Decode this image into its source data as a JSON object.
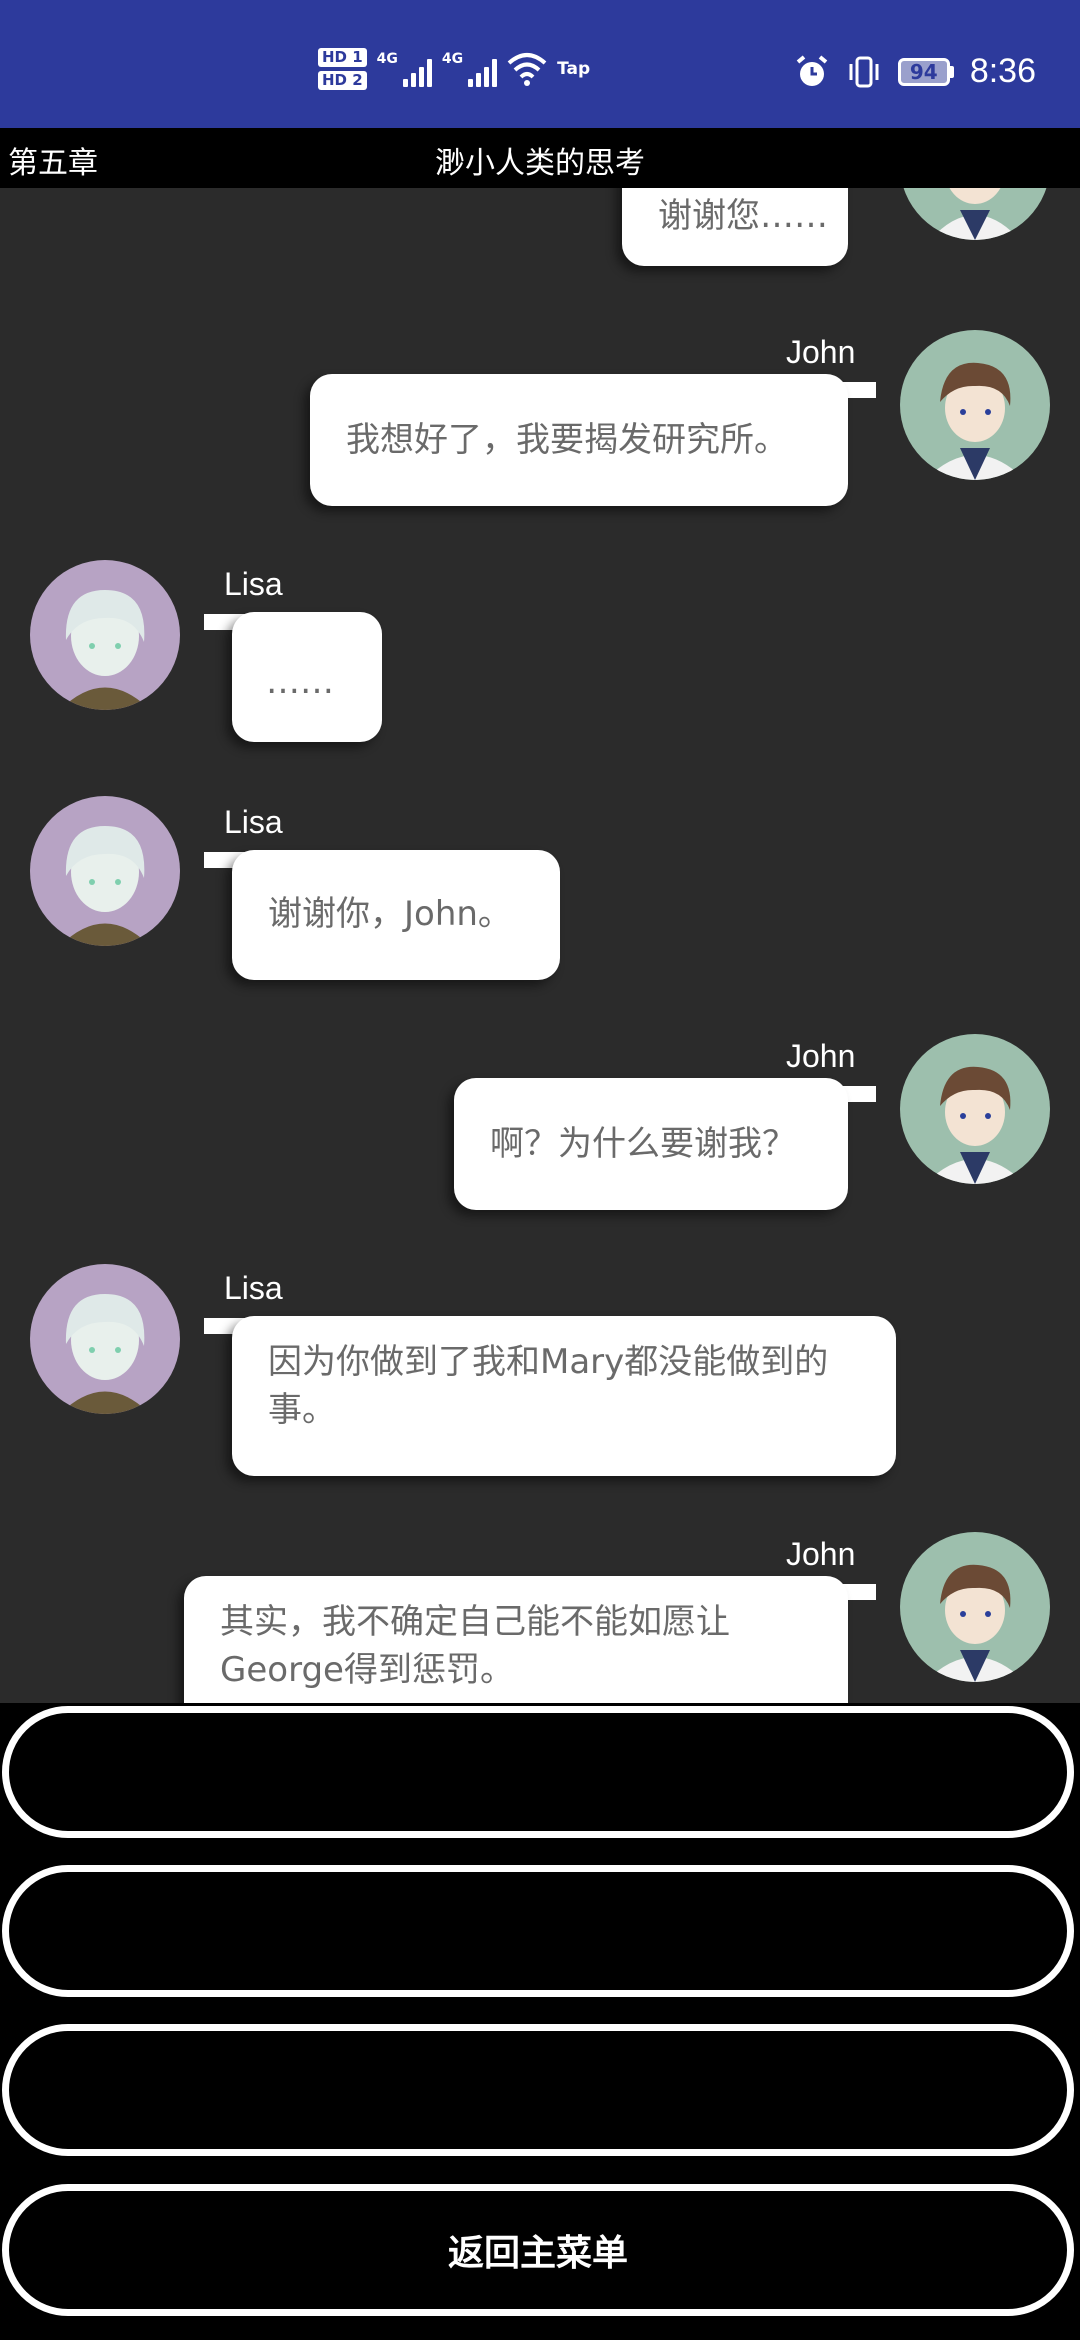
{
  "status_bar": {
    "hd1": "HD 1",
    "hd2": "HD 2",
    "net1": "4G",
    "net2": "4G",
    "tap": "Tap",
    "battery": "94",
    "time": "8:36"
  },
  "title_bar": {
    "chapter": "第五章",
    "title": "渺小人类的思考"
  },
  "messages": [
    {
      "sender": "",
      "text": "谢谢您……"
    },
    {
      "sender": "John",
      "text": "我想好了，我要揭发研究所。"
    },
    {
      "sender": "Lisa",
      "text": "……"
    },
    {
      "sender": "Lisa",
      "text": "谢谢你，John。"
    },
    {
      "sender": "John",
      "text": "啊？为什么要谢我？"
    },
    {
      "sender": "Lisa",
      "text": "因为你做到了我和Mary都没能做到的事。"
    },
    {
      "sender": "John",
      "text": "其实，我不确定自己能不能如愿让George得到惩罚。"
    }
  ],
  "choices": [
    "",
    "",
    ""
  ],
  "menu_button": "返回主菜单"
}
